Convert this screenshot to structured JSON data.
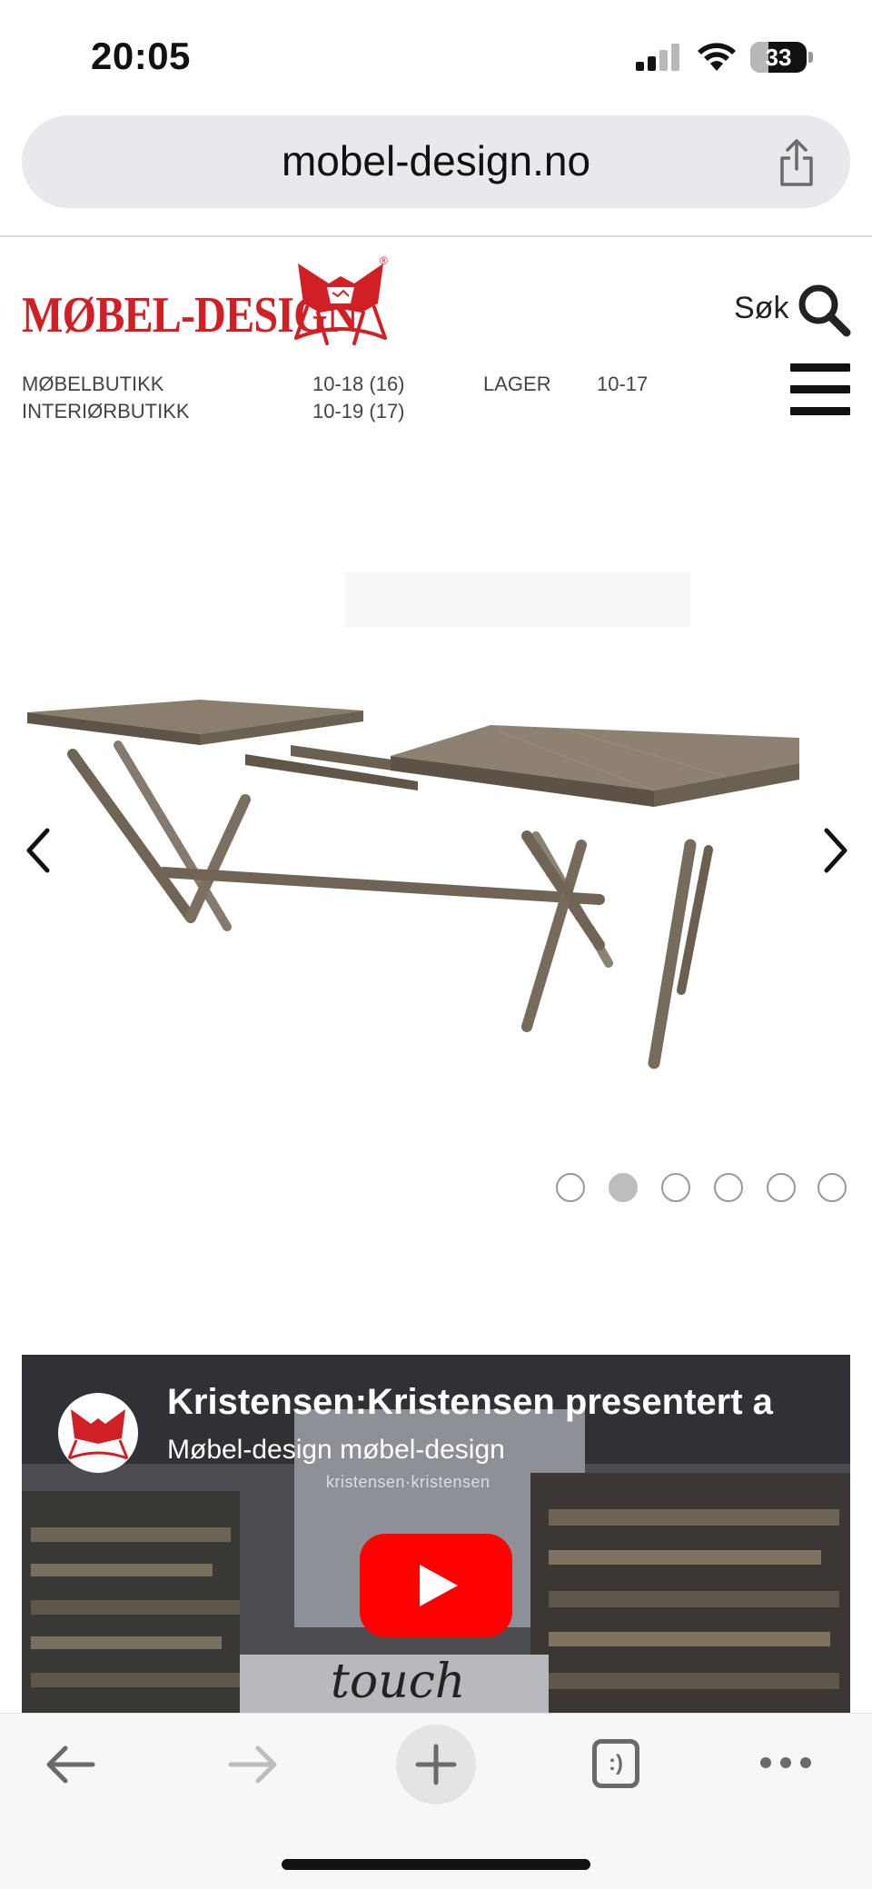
{
  "status_bar": {
    "time": "20:05",
    "battery_level": "33",
    "icons": [
      "cellular-signal-icon",
      "wifi-icon",
      "battery-icon"
    ]
  },
  "browser": {
    "url": "mobel-design.no",
    "share_icon": "share-icon"
  },
  "site": {
    "logo_text": "MØBEL-DESIGN",
    "logo_icon": "butterfly-chair-icon",
    "logo_registered": "®",
    "search_label": "Søk",
    "search_icon": "search-icon",
    "menu_icon": "hamburger-menu-icon",
    "hours": [
      {
        "label": "MØBELBUTIKK",
        "time": "10-18 (16)"
      },
      {
        "label": "INTERIØRBUTIKK",
        "time": "10-19 (17)"
      },
      {
        "label": "LAGER",
        "time": "10-17"
      }
    ]
  },
  "carousel": {
    "prev_icon": "chevron-left-icon",
    "next_icon": "chevron-right-icon",
    "slide_count": 6,
    "active_index": 1,
    "image_subject": "extendable-wooden-dining-table"
  },
  "video": {
    "title": "Kristensen:Kristensen presentert a",
    "channel": "Møbel-design møbel-design",
    "watermark": "kristensen·kristensen",
    "script_text": "touch",
    "play_icon": "youtube-play-icon"
  },
  "toolbar": {
    "icons": [
      "back-arrow-icon",
      "forward-arrow-icon",
      "new-tab-plus-icon",
      "tabs-icon",
      "more-icon"
    ],
    "tabs_glyph": ":)"
  },
  "colors": {
    "brand_red": "#d11f26",
    "url_bar_bg": "#e7e9ec",
    "youtube_red": "#ff0000"
  }
}
